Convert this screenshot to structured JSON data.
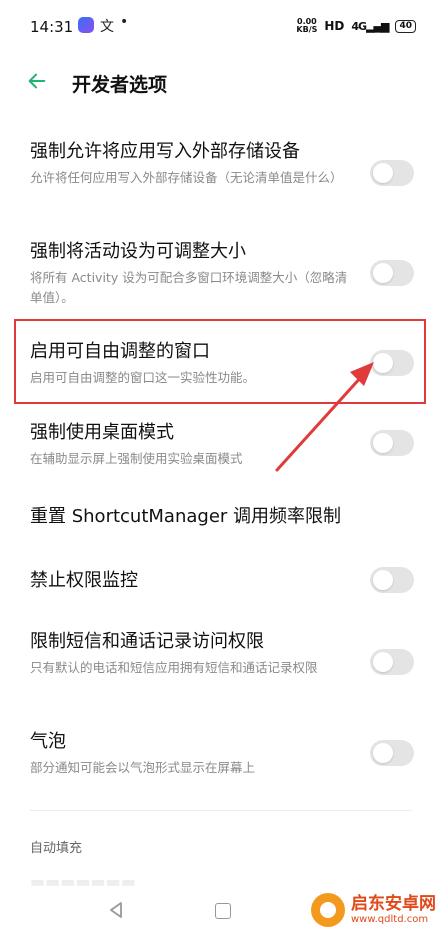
{
  "status_bar": {
    "time": "14:31",
    "app_glyph": "文",
    "dot": "•",
    "speed_value": "0.00",
    "speed_unit": "KB/S",
    "hd": "HD",
    "signal": "4G",
    "battery": "40"
  },
  "header": {
    "title": "开发者选项",
    "back_icon": "arrow-left-icon",
    "accent": "#1fb570"
  },
  "settings": [
    {
      "title": "强制允许将应用写入外部存储设备",
      "subtitle": "允许将任何应用写入外部存储设备（无论清单值是什么）",
      "toggle": false
    },
    {
      "title": "强制将活动设为可调整大小",
      "subtitle": "将所有 Activity 设为可配合多窗口环境调整大小（忽略清单值）。",
      "toggle": false
    },
    {
      "title": "启用可自由调整的窗口",
      "subtitle": "启用可自由调整的窗口这一实验性功能。",
      "toggle": false
    },
    {
      "title": "强制使用桌面模式",
      "subtitle": "在辅助显示屏上强制使用实验桌面模式",
      "toggle": false
    },
    {
      "title": "重置 ShortcutManager 调用频率限制",
      "subtitle": ""
    },
    {
      "title": "禁止权限监控",
      "subtitle": "",
      "toggle": false
    },
    {
      "title": "限制短信和通话记录访问权限",
      "subtitle": "只有默认的电话和短信应用拥有短信和通话记录权限",
      "toggle": false
    },
    {
      "title": "气泡",
      "subtitle": "部分通知可能会以气泡形式显示在屏幕上",
      "toggle": false
    }
  ],
  "section": {
    "label": "自动填充"
  },
  "highlight_color": "#e03a3a",
  "watermark": {
    "name": "启东安卓网",
    "url": "www.qdltd.com"
  }
}
